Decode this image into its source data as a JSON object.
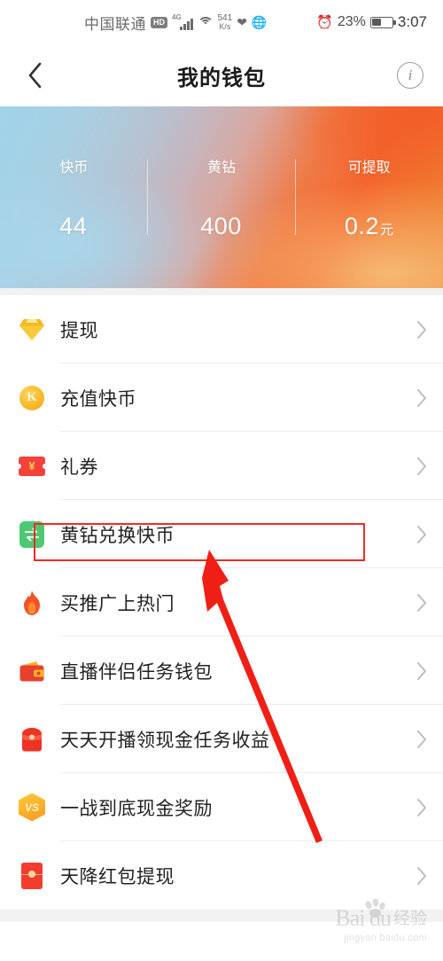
{
  "status_bar": {
    "carrier": "中国联通",
    "hd_badge": "HD",
    "network_type": "4G",
    "net_speed_value": "541",
    "net_speed_unit": "K/s",
    "heart_icon": "heart-icon",
    "globe_icon": "globe-icon",
    "alarm_icon": "alarm-clock-icon",
    "battery_percent": "23%",
    "battery_level": 23,
    "clock": "3:07"
  },
  "nav": {
    "back_icon": "chevron-left-icon",
    "title": "我的钱包",
    "info_icon": "info-icon",
    "info_glyph": "i"
  },
  "banner": {
    "gradient_start": "#9fd4ea",
    "gradient_end": "#f4652c",
    "stats": [
      {
        "label": "快币",
        "value": "44",
        "unit": ""
      },
      {
        "label": "黄钻",
        "value": "400",
        "unit": ""
      },
      {
        "label": "可提取",
        "value": "0.2",
        "unit": "元"
      }
    ]
  },
  "list": {
    "chevron_icon": "chevron-right-icon",
    "items": [
      {
        "label": "提现",
        "icon": "diamond-icon",
        "color": "#f5c233"
      },
      {
        "label": "充值快币",
        "icon": "k-coin-icon",
        "color": "#f7b626"
      },
      {
        "label": "礼券",
        "icon": "coupon-ticket-icon",
        "color": "#f5403c"
      },
      {
        "label": "黄钻兑换快币",
        "icon": "exchange-icon",
        "color": "#4ec973"
      },
      {
        "label": "买推广上热门",
        "icon": "flame-icon",
        "color": "#f4512a"
      },
      {
        "label": "直播伴侣任务钱包",
        "icon": "wallet-icon",
        "color": "#e8402e"
      },
      {
        "label": "天天开播领现金任务收益",
        "icon": "gift-pouch-icon",
        "color": "#ee3322"
      },
      {
        "label": "一战到底现金奖励",
        "icon": "vs-badge-icon",
        "color": "#f79a1e",
        "badge_text": "VS"
      },
      {
        "label": "天降红包提现",
        "icon": "red-envelope-icon",
        "color": "#f23c2e"
      }
    ]
  },
  "annotation": {
    "highlight_color": "#ee2b24",
    "highlight_target": "黄钻兑换快币",
    "arrow_color": "#f01f16"
  },
  "watermark": {
    "brand": "Bai du",
    "suffix": "经验",
    "url": "jingyan.baidu.com"
  }
}
